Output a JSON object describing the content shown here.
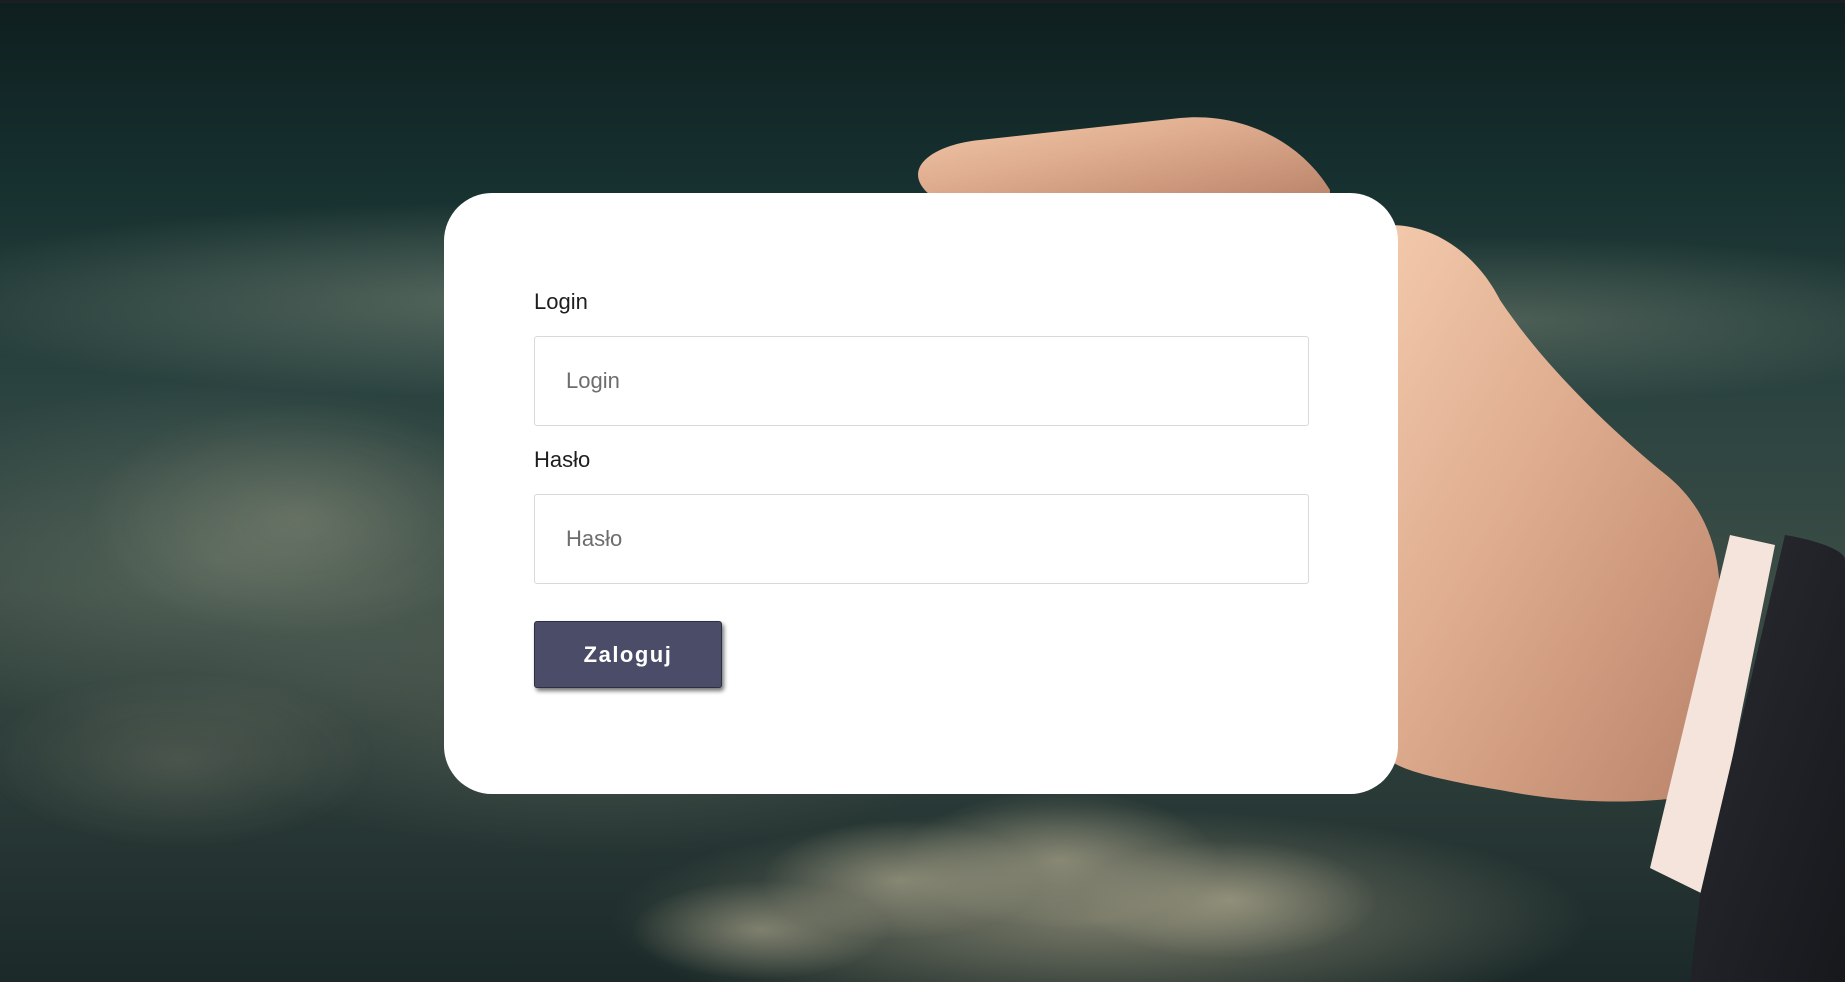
{
  "form": {
    "login_label": "Login",
    "login_placeholder": "Login",
    "login_value": "",
    "password_label": "Hasło",
    "password_placeholder": "Hasło",
    "password_value": "",
    "submit_label": "Zaloguj"
  },
  "colors": {
    "card_background": "#ffffff",
    "button_background": "#4a4c68",
    "button_text": "#ffffff",
    "label_text": "#1e1e1e",
    "input_border": "#d9d9d9"
  },
  "icons": {
    "background": "hand-holding-card-over-clouds-photo"
  }
}
